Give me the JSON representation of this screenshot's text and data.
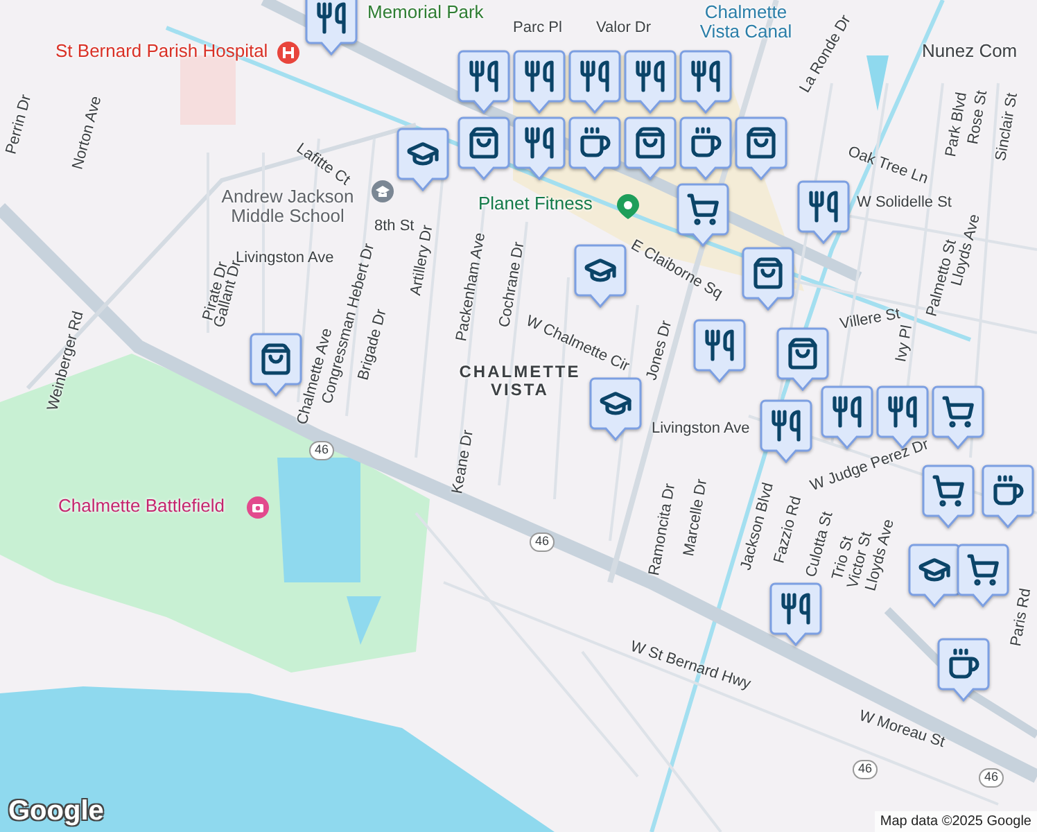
{
  "map": {
    "labels": [
      {
        "text": "St Bernard Parish Hospital",
        "kind": "poi-red"
      },
      {
        "text": "Memorial Park",
        "kind": "park"
      },
      {
        "text": "Chalmette Vista Canal",
        "kind": "water"
      },
      {
        "text": "Nunez Com",
        "kind": "area"
      },
      {
        "text": "Andrew Jackson Middle School",
        "kind": "poi-gray"
      },
      {
        "text": "Planet Fitness",
        "kind": "poi-green"
      },
      {
        "text": "CHALMETTE VISTA",
        "kind": "district"
      },
      {
        "text": "Chalmette Battlefield",
        "kind": "poi-pink"
      },
      {
        "text": "Parc Pl",
        "kind": "street"
      },
      {
        "text": "Valor Dr",
        "kind": "street"
      },
      {
        "text": "La Ronde Dr",
        "kind": "street"
      },
      {
        "text": "Oak Tree Ln",
        "kind": "street"
      },
      {
        "text": "W Solidelle St",
        "kind": "street"
      },
      {
        "text": "Park Blvd",
        "kind": "street"
      },
      {
        "text": "Rose St",
        "kind": "street"
      },
      {
        "text": "Sinclair St",
        "kind": "street"
      },
      {
        "text": "Lafitte Ct",
        "kind": "street"
      },
      {
        "text": "8th St",
        "kind": "street"
      },
      {
        "text": "Livingston Ave",
        "kind": "street"
      },
      {
        "text": "Artillery Dr",
        "kind": "street"
      },
      {
        "text": "Packenham Ave",
        "kind": "street"
      },
      {
        "text": "Cochrane Dr",
        "kind": "street"
      },
      {
        "text": "E Claiborne Sq",
        "kind": "street"
      },
      {
        "text": "W Chalmette Cir",
        "kind": "street"
      },
      {
        "text": "Jones Dr",
        "kind": "street"
      },
      {
        "text": "Villere St",
        "kind": "street"
      },
      {
        "text": "Ivy Pl",
        "kind": "street"
      },
      {
        "text": "Palmetto St",
        "kind": "street"
      },
      {
        "text": "Lloyds Ave",
        "kind": "street"
      },
      {
        "text": "Pirate Dr",
        "kind": "street"
      },
      {
        "text": "Gallant Dr",
        "kind": "street"
      },
      {
        "text": "Chalmette Ave",
        "kind": "street"
      },
      {
        "text": "Congressman Hebert Dr",
        "kind": "street"
      },
      {
        "text": "Brigade Dr",
        "kind": "street"
      },
      {
        "text": "Keane Dr",
        "kind": "street"
      },
      {
        "text": "Livingston Ave",
        "kind": "street"
      },
      {
        "text": "Ramoncita Dr",
        "kind": "street"
      },
      {
        "text": "Marcelle Dr",
        "kind": "street"
      },
      {
        "text": "Jackson Blvd",
        "kind": "street"
      },
      {
        "text": "Fazzio Rd",
        "kind": "street"
      },
      {
        "text": "Culotta St",
        "kind": "street"
      },
      {
        "text": "Trio St",
        "kind": "street"
      },
      {
        "text": "Victor St",
        "kind": "street"
      },
      {
        "text": "Lloyds Ave",
        "kind": "street"
      },
      {
        "text": "W Judge Perez Dr",
        "kind": "street"
      },
      {
        "text": "W St Bernard Hwy",
        "kind": "street"
      },
      {
        "text": "W Moreau St",
        "kind": "street"
      },
      {
        "text": "Paris Rd",
        "kind": "street"
      },
      {
        "text": "Weinberger Rd",
        "kind": "street"
      },
      {
        "text": "Norton Ave",
        "kind": "street"
      },
      {
        "text": "Perrin Dr",
        "kind": "street"
      },
      {
        "text": "46",
        "kind": "shield"
      },
      {
        "text": "46",
        "kind": "shield"
      },
      {
        "text": "46",
        "kind": "shield"
      },
      {
        "text": "46",
        "kind": "shield"
      }
    ],
    "pins": [
      {
        "kind": "restaurant"
      },
      {
        "kind": "school"
      },
      {
        "kind": "restaurant"
      },
      {
        "kind": "restaurant"
      },
      {
        "kind": "restaurant"
      },
      {
        "kind": "restaurant"
      },
      {
        "kind": "restaurant"
      },
      {
        "kind": "bag"
      },
      {
        "kind": "restaurant"
      },
      {
        "kind": "cup"
      },
      {
        "kind": "bag"
      },
      {
        "kind": "cup"
      },
      {
        "kind": "cart"
      },
      {
        "kind": "bag"
      },
      {
        "kind": "restaurant"
      },
      {
        "kind": "school"
      },
      {
        "kind": "bag"
      },
      {
        "kind": "restaurant"
      },
      {
        "kind": "bag"
      },
      {
        "kind": "restaurant"
      },
      {
        "kind": "bag"
      },
      {
        "kind": "school"
      },
      {
        "kind": "restaurant"
      },
      {
        "kind": "restaurant"
      },
      {
        "kind": "cart"
      },
      {
        "kind": "cart"
      },
      {
        "kind": "cup"
      },
      {
        "kind": "school"
      },
      {
        "kind": "cart"
      },
      {
        "kind": "restaurant"
      },
      {
        "kind": "cup"
      }
    ],
    "logo": "Google",
    "attribution": "Map data ©2025 Google"
  }
}
